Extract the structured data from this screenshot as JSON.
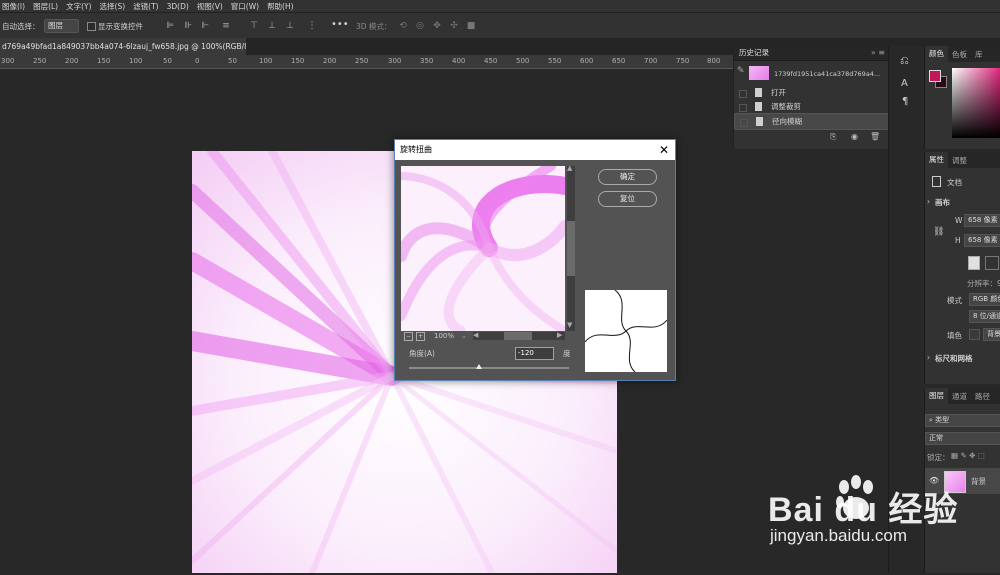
{
  "menu": [
    "图像(I)",
    "图层(L)",
    "文字(Y)",
    "选择(S)",
    "滤镜(T)",
    "3D(D)",
    "视图(V)",
    "窗口(W)",
    "帮助(H)"
  ],
  "options": {
    "auto_select_label": "自动选择：",
    "auto_select_value": "图层",
    "show_transform_label": "显示变换控件",
    "more": "•••",
    "mode_3d_label": "3D 模式："
  },
  "doc": {
    "tab_title": "d769a49bfad1a849037bb4a074-6lzauj_fw658.jpg @ 100%(RGB/8#) *",
    "ruler_ticks": [
      "300",
      "250",
      "200",
      "150",
      "100",
      "50",
      "0",
      "50",
      "100",
      "150",
      "200",
      "250",
      "300",
      "350",
      "400",
      "450",
      "500",
      "550",
      "600",
      "650",
      "700",
      "750",
      "800"
    ]
  },
  "history": {
    "title": "历史记录",
    "snapshot_name": "1739fd1951ca41ca378d769a4...",
    "items": [
      {
        "label": "打开",
        "selected": false
      },
      {
        "label": "调整裁剪",
        "selected": false
      },
      {
        "label": "径向模糊",
        "selected": true
      }
    ]
  },
  "color_panel": {
    "tabs": [
      "颜色",
      "色板",
      "库"
    ],
    "foreground": "#c2185b",
    "background": "#2a0a16"
  },
  "properties": {
    "tabs": [
      "属性",
      "调整"
    ],
    "doc_label": "文档",
    "section_canvas": "画布",
    "w_label": "W",
    "w_value": "658 像素",
    "h_label": "H",
    "h_value": "658 像素",
    "resolution": "分辨率：96",
    "mode_label": "模式",
    "mode_value": "RGB 颜色",
    "depth_value": "8 位/通道",
    "fill_label": "填色",
    "fill_value": "背景",
    "section_rulers": "标尺和网格"
  },
  "layers": {
    "tabs": [
      "图层",
      "通道",
      "路径"
    ],
    "filter_value": "类型",
    "blend_value": "正常",
    "lock_label": "锁定：",
    "layer_name": "背景"
  },
  "dialog": {
    "title": "旋转扭曲",
    "ok_label": "确定",
    "reset_label": "复位",
    "zoom_value": "100%",
    "angle_label": "角度(A)",
    "angle_value": "-120",
    "angle_unit": "度",
    "angle_min": -999,
    "angle_max": 999
  },
  "watermark": {
    "brand": "Bai du 经验",
    "url": "jingyan.baidu.com"
  }
}
